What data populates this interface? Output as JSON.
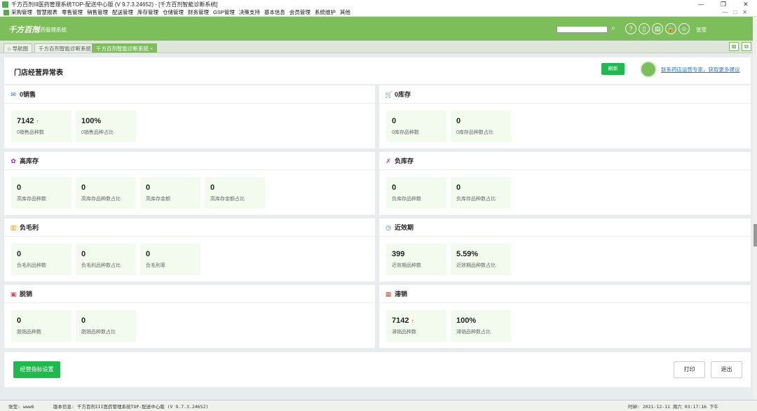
{
  "window": {
    "title": "千方百剂III医药管理系统TOP-配送中心版 (V 9.7.3.24652)  - [千方百剂智能诊断系统]",
    "minimize": "—",
    "restore": "❐",
    "close": "✕"
  },
  "menu": {
    "items": [
      "采购管理",
      "智慧报表",
      "零售管理",
      "销售管理",
      "配送管理",
      "库存管理",
      "仓储管理",
      "财务管理",
      "GSP管理",
      "决策支持",
      "基本信息",
      "会员管理",
      "系统维护",
      "其他"
    ],
    "right": [
      "—",
      "□",
      "✕"
    ]
  },
  "header": {
    "logo": "千方百剂",
    "logo_sub": "医药管理系统",
    "search_placeholder": "",
    "search_icon": "⌕",
    "icons": [
      "?",
      "▯",
      "▤",
      "🔒",
      "☺"
    ],
    "user": "张莹"
  },
  "tabs": [
    {
      "label": "⌂ 导航图"
    },
    {
      "label": "千方百剂智能诊断系统"
    },
    {
      "label": "千方百剂智能诊断系统 ×"
    }
  ],
  "page": {
    "title": "门店经营异常表",
    "refresh": "刷新",
    "helper_link": "联系药店运营专家，获取更多建议"
  },
  "panels": [
    {
      "title": "0销售",
      "icon": "✉",
      "icon_color": "#2a77d4",
      "cards": [
        {
          "value": "7142",
          "up": "↑",
          "label": "0销售品种数"
        },
        {
          "value": "100%",
          "up": "",
          "label": "0销售品种占比"
        }
      ]
    },
    {
      "title": "0库存",
      "icon": "🛒",
      "icon_color": "#1fba4d",
      "cards": [
        {
          "value": "0",
          "up": "",
          "label": "0库存品种数"
        },
        {
          "value": "0",
          "up": "",
          "label": "0库存品种数占比"
        }
      ]
    },
    {
      "title": "高库存",
      "icon": "✿",
      "icon_color": "#a020d0",
      "cards": [
        {
          "value": "0",
          "up": "",
          "label": "高库存品种数"
        },
        {
          "value": "0",
          "up": "",
          "label": "高库存品种数占比"
        },
        {
          "value": "0",
          "up": "",
          "label": "高库存金额"
        },
        {
          "value": "0",
          "up": "",
          "label": "高库存金额占比"
        }
      ]
    },
    {
      "title": "负库存",
      "icon": "✗",
      "icon_color": "#e53970",
      "cards": [
        {
          "value": "0",
          "up": "",
          "label": "负库存品种数"
        },
        {
          "value": "0",
          "up": "",
          "label": "负库存品种数占比"
        }
      ]
    },
    {
      "title": "负毛利",
      "icon": "▥",
      "icon_color": "#f09020",
      "cards": [
        {
          "value": "0",
          "up": "",
          "label": "负毛利品种数"
        },
        {
          "value": "0",
          "up": "",
          "label": "负毛利品种数占比"
        },
        {
          "value": "0",
          "up": "",
          "label": "负毛利率"
        }
      ]
    },
    {
      "title": "近效期",
      "icon": "◷",
      "icon_color": "#2a77d4",
      "cards": [
        {
          "value": "399",
          "up": "",
          "label": "近效期品种数"
        },
        {
          "value": "5.59%",
          "up": "",
          "label": "近效期品种数占比"
        }
      ]
    },
    {
      "title": "脱销",
      "icon": "▣",
      "icon_color": "#e53970",
      "cards": [
        {
          "value": "0",
          "up": "",
          "label": "脱销品种数"
        },
        {
          "value": "0",
          "up": "",
          "label": "脱销品种数占比"
        }
      ]
    },
    {
      "title": "滞销",
      "icon": "▦",
      "icon_color": "#e05030",
      "cards": [
        {
          "value": "7142",
          "up": "↑",
          "label": "滞销品种数"
        },
        {
          "value": "100%",
          "up": "",
          "label": "滞销品种数占比"
        }
      ]
    }
  ],
  "footer": {
    "settings": "经营指标设置",
    "print": "打印",
    "exit": "退出"
  },
  "status": {
    "user": "张莹: www6",
    "version": "版本信息: 千方百剂III医药管理系统TOP-配送中心版 (V 9.7.3.24652)",
    "time": "时钟: 2021-12-11 周六 03:17:16 下午"
  }
}
